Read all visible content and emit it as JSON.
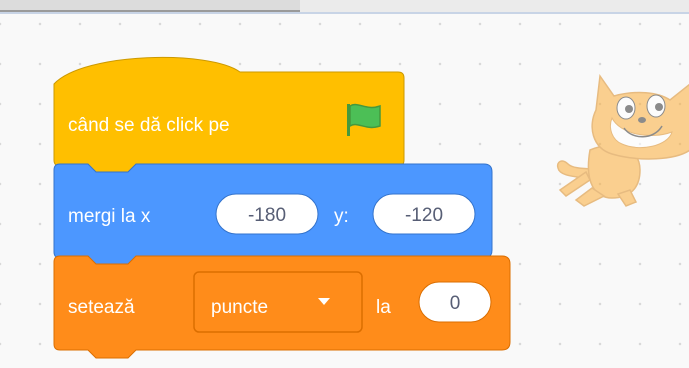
{
  "colors": {
    "events": "#ffbf00",
    "motion": "#4c97ff",
    "variables": "#ff8c1a",
    "flag": "#2fa82f"
  },
  "blocks": {
    "when_flag": {
      "label": "când se dă click pe",
      "icon": "green-flag-icon"
    },
    "goto_xy": {
      "label": "mergi la x",
      "x_value": "-180",
      "y_label": "y:",
      "y_value": "-120"
    },
    "set_variable": {
      "label": "setează",
      "variable": "puncte",
      "to_label": "la",
      "value": "0"
    }
  },
  "sprite": {
    "icon": "cat-sprite-icon"
  }
}
